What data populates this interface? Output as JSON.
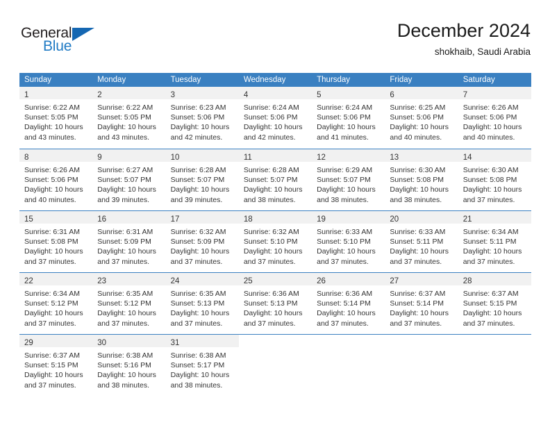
{
  "brand": {
    "name_top": "General",
    "name_bottom": "Blue",
    "color_dark": "#231f20",
    "color_blue": "#1f7ac4"
  },
  "header": {
    "title": "December 2024",
    "subtitle": "shokhaib, Saudi Arabia"
  },
  "calendar": {
    "header_bg": "#3a80c1",
    "day_band_bg": "#f1f1f1",
    "weekdays": [
      "Sunday",
      "Monday",
      "Tuesday",
      "Wednesday",
      "Thursday",
      "Friday",
      "Saturday"
    ],
    "weeks": [
      [
        {
          "day": "1",
          "sunrise": "Sunrise: 6:22 AM",
          "sunset": "Sunset: 5:05 PM",
          "daylight1": "Daylight: 10 hours",
          "daylight2": "and 43 minutes."
        },
        {
          "day": "2",
          "sunrise": "Sunrise: 6:22 AM",
          "sunset": "Sunset: 5:05 PM",
          "daylight1": "Daylight: 10 hours",
          "daylight2": "and 43 minutes."
        },
        {
          "day": "3",
          "sunrise": "Sunrise: 6:23 AM",
          "sunset": "Sunset: 5:06 PM",
          "daylight1": "Daylight: 10 hours",
          "daylight2": "and 42 minutes."
        },
        {
          "day": "4",
          "sunrise": "Sunrise: 6:24 AM",
          "sunset": "Sunset: 5:06 PM",
          "daylight1": "Daylight: 10 hours",
          "daylight2": "and 42 minutes."
        },
        {
          "day": "5",
          "sunrise": "Sunrise: 6:24 AM",
          "sunset": "Sunset: 5:06 PM",
          "daylight1": "Daylight: 10 hours",
          "daylight2": "and 41 minutes."
        },
        {
          "day": "6",
          "sunrise": "Sunrise: 6:25 AM",
          "sunset": "Sunset: 5:06 PM",
          "daylight1": "Daylight: 10 hours",
          "daylight2": "and 40 minutes."
        },
        {
          "day": "7",
          "sunrise": "Sunrise: 6:26 AM",
          "sunset": "Sunset: 5:06 PM",
          "daylight1": "Daylight: 10 hours",
          "daylight2": "and 40 minutes."
        }
      ],
      [
        {
          "day": "8",
          "sunrise": "Sunrise: 6:26 AM",
          "sunset": "Sunset: 5:06 PM",
          "daylight1": "Daylight: 10 hours",
          "daylight2": "and 40 minutes."
        },
        {
          "day": "9",
          "sunrise": "Sunrise: 6:27 AM",
          "sunset": "Sunset: 5:07 PM",
          "daylight1": "Daylight: 10 hours",
          "daylight2": "and 39 minutes."
        },
        {
          "day": "10",
          "sunrise": "Sunrise: 6:28 AM",
          "sunset": "Sunset: 5:07 PM",
          "daylight1": "Daylight: 10 hours",
          "daylight2": "and 39 minutes."
        },
        {
          "day": "11",
          "sunrise": "Sunrise: 6:28 AM",
          "sunset": "Sunset: 5:07 PM",
          "daylight1": "Daylight: 10 hours",
          "daylight2": "and 38 minutes."
        },
        {
          "day": "12",
          "sunrise": "Sunrise: 6:29 AM",
          "sunset": "Sunset: 5:07 PM",
          "daylight1": "Daylight: 10 hours",
          "daylight2": "and 38 minutes."
        },
        {
          "day": "13",
          "sunrise": "Sunrise: 6:30 AM",
          "sunset": "Sunset: 5:08 PM",
          "daylight1": "Daylight: 10 hours",
          "daylight2": "and 38 minutes."
        },
        {
          "day": "14",
          "sunrise": "Sunrise: 6:30 AM",
          "sunset": "Sunset: 5:08 PM",
          "daylight1": "Daylight: 10 hours",
          "daylight2": "and 37 minutes."
        }
      ],
      [
        {
          "day": "15",
          "sunrise": "Sunrise: 6:31 AM",
          "sunset": "Sunset: 5:08 PM",
          "daylight1": "Daylight: 10 hours",
          "daylight2": "and 37 minutes."
        },
        {
          "day": "16",
          "sunrise": "Sunrise: 6:31 AM",
          "sunset": "Sunset: 5:09 PM",
          "daylight1": "Daylight: 10 hours",
          "daylight2": "and 37 minutes."
        },
        {
          "day": "17",
          "sunrise": "Sunrise: 6:32 AM",
          "sunset": "Sunset: 5:09 PM",
          "daylight1": "Daylight: 10 hours",
          "daylight2": "and 37 minutes."
        },
        {
          "day": "18",
          "sunrise": "Sunrise: 6:32 AM",
          "sunset": "Sunset: 5:10 PM",
          "daylight1": "Daylight: 10 hours",
          "daylight2": "and 37 minutes."
        },
        {
          "day": "19",
          "sunrise": "Sunrise: 6:33 AM",
          "sunset": "Sunset: 5:10 PM",
          "daylight1": "Daylight: 10 hours",
          "daylight2": "and 37 minutes."
        },
        {
          "day": "20",
          "sunrise": "Sunrise: 6:33 AM",
          "sunset": "Sunset: 5:11 PM",
          "daylight1": "Daylight: 10 hours",
          "daylight2": "and 37 minutes."
        },
        {
          "day": "21",
          "sunrise": "Sunrise: 6:34 AM",
          "sunset": "Sunset: 5:11 PM",
          "daylight1": "Daylight: 10 hours",
          "daylight2": "and 37 minutes."
        }
      ],
      [
        {
          "day": "22",
          "sunrise": "Sunrise: 6:34 AM",
          "sunset": "Sunset: 5:12 PM",
          "daylight1": "Daylight: 10 hours",
          "daylight2": "and 37 minutes."
        },
        {
          "day": "23",
          "sunrise": "Sunrise: 6:35 AM",
          "sunset": "Sunset: 5:12 PM",
          "daylight1": "Daylight: 10 hours",
          "daylight2": "and 37 minutes."
        },
        {
          "day": "24",
          "sunrise": "Sunrise: 6:35 AM",
          "sunset": "Sunset: 5:13 PM",
          "daylight1": "Daylight: 10 hours",
          "daylight2": "and 37 minutes."
        },
        {
          "day": "25",
          "sunrise": "Sunrise: 6:36 AM",
          "sunset": "Sunset: 5:13 PM",
          "daylight1": "Daylight: 10 hours",
          "daylight2": "and 37 minutes."
        },
        {
          "day": "26",
          "sunrise": "Sunrise: 6:36 AM",
          "sunset": "Sunset: 5:14 PM",
          "daylight1": "Daylight: 10 hours",
          "daylight2": "and 37 minutes."
        },
        {
          "day": "27",
          "sunrise": "Sunrise: 6:37 AM",
          "sunset": "Sunset: 5:14 PM",
          "daylight1": "Daylight: 10 hours",
          "daylight2": "and 37 minutes."
        },
        {
          "day": "28",
          "sunrise": "Sunrise: 6:37 AM",
          "sunset": "Sunset: 5:15 PM",
          "daylight1": "Daylight: 10 hours",
          "daylight2": "and 37 minutes."
        }
      ],
      [
        {
          "day": "29",
          "sunrise": "Sunrise: 6:37 AM",
          "sunset": "Sunset: 5:15 PM",
          "daylight1": "Daylight: 10 hours",
          "daylight2": "and 37 minutes."
        },
        {
          "day": "30",
          "sunrise": "Sunrise: 6:38 AM",
          "sunset": "Sunset: 5:16 PM",
          "daylight1": "Daylight: 10 hours",
          "daylight2": "and 38 minutes."
        },
        {
          "day": "31",
          "sunrise": "Sunrise: 6:38 AM",
          "sunset": "Sunset: 5:17 PM",
          "daylight1": "Daylight: 10 hours",
          "daylight2": "and 38 minutes."
        },
        {
          "day": "",
          "sunrise": "",
          "sunset": "",
          "daylight1": "",
          "daylight2": ""
        },
        {
          "day": "",
          "sunrise": "",
          "sunset": "",
          "daylight1": "",
          "daylight2": ""
        },
        {
          "day": "",
          "sunrise": "",
          "sunset": "",
          "daylight1": "",
          "daylight2": ""
        },
        {
          "day": "",
          "sunrise": "",
          "sunset": "",
          "daylight1": "",
          "daylight2": ""
        }
      ]
    ]
  }
}
